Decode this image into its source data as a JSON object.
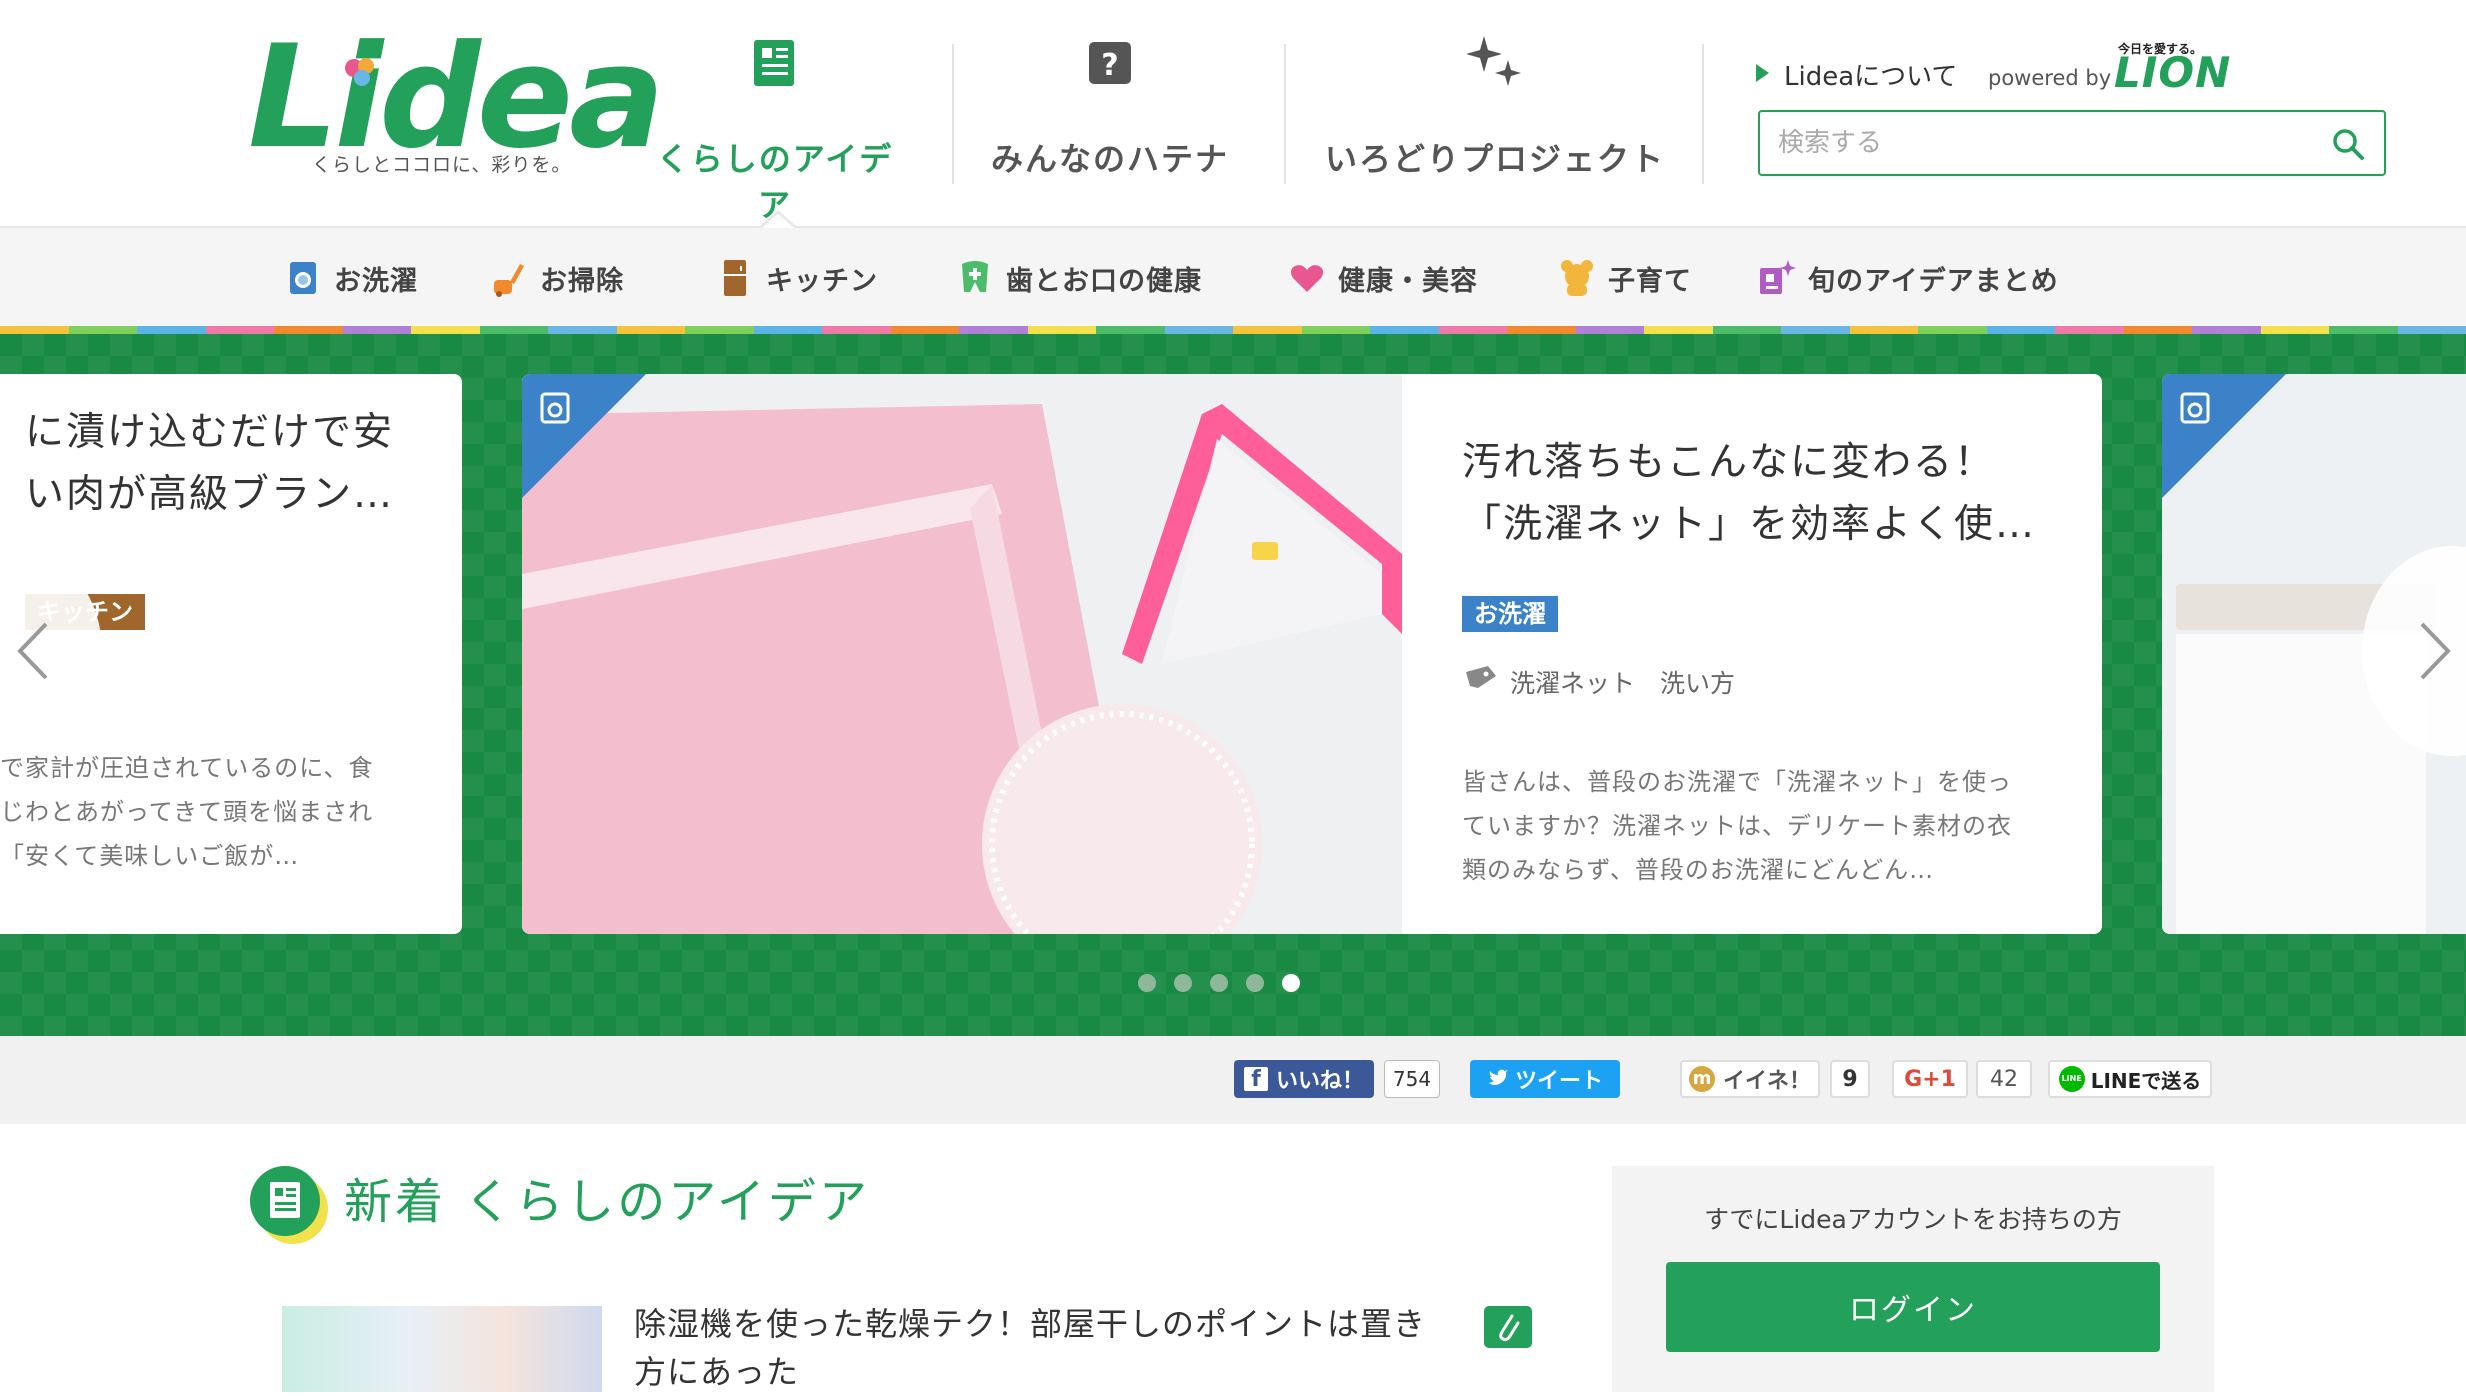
{
  "header": {
    "logo": "Lidea",
    "logo_tagline": "くらしとココロに、彩りを。",
    "nav": [
      {
        "label": "くらしのアイデア",
        "icon": "news-icon",
        "active": true
      },
      {
        "label": "みんなのハテナ",
        "icon": "question-icon",
        "active": false
      },
      {
        "label": "いろどりプロジェクト",
        "icon": "sparkle-icon",
        "active": false
      }
    ],
    "about_label": "Lideaについて",
    "powered_by": "powered by",
    "lion_tagline": "今日を愛する。",
    "lion_logo": "LION",
    "search_placeholder": "検索する"
  },
  "categories": [
    {
      "label": "お洗濯",
      "icon": "washing-machine-icon"
    },
    {
      "label": "お掃除",
      "icon": "vacuum-icon"
    },
    {
      "label": "キッチン",
      "icon": "refrigerator-icon"
    },
    {
      "label": "歯とお口の健康",
      "icon": "tooth-icon"
    },
    {
      "label": "健康・美容",
      "icon": "heart-icon"
    },
    {
      "label": "子育て",
      "icon": "bear-icon"
    },
    {
      "label": "旬のアイデアまとめ",
      "icon": "idea-collection-icon"
    }
  ],
  "carousel": {
    "left_card": {
      "title_lines": [
        "に漬け込むだけで安",
        "い肉が高級ブラン…"
      ],
      "tag": "キッチン",
      "text_lines": [
        "で家計が圧迫されているのに、食",
        "じわとあがってきて頭を悩まされ",
        "「安くて美味しいご飯が…"
      ]
    },
    "main_card": {
      "title_lines": [
        "汚れ落ちもこんなに変わる！",
        "「洗濯ネット」を効率よく使…"
      ],
      "tag": "お洗濯",
      "keywords": "洗濯ネット　洗い方",
      "text_lines": [
        "皆さんは、普段のお洗濯で「洗濯ネット」を使っ",
        "ていますか？洗濯ネットは、デリケート素材の衣",
        "類のみならず、普段のお洗濯にどんどん…"
      ]
    },
    "slide_count": 5,
    "active_slide": 5
  },
  "social": {
    "facebook_label": "いいね！",
    "facebook_count": "754",
    "tweet_label": "ツイート",
    "mixi_label": "イイネ！",
    "mixi_count": "9",
    "gplus_label": "G+1",
    "gplus_count": "42",
    "line_label": "LINEで送る"
  },
  "new_section": {
    "title": "新着 くらしのアイデア",
    "article_title": "除湿機を使った乾燥テク！部屋干しのポイントは置き方にあった"
  },
  "login": {
    "prompt": "すでにLideaアカウントをお持ちの方",
    "button": "ログイン"
  },
  "colors": {
    "brand_green": "#23a05a",
    "carousel_green": "#198a44",
    "laundry_blue": "#3c82c8",
    "kitchen_brown": "#a0662c"
  }
}
